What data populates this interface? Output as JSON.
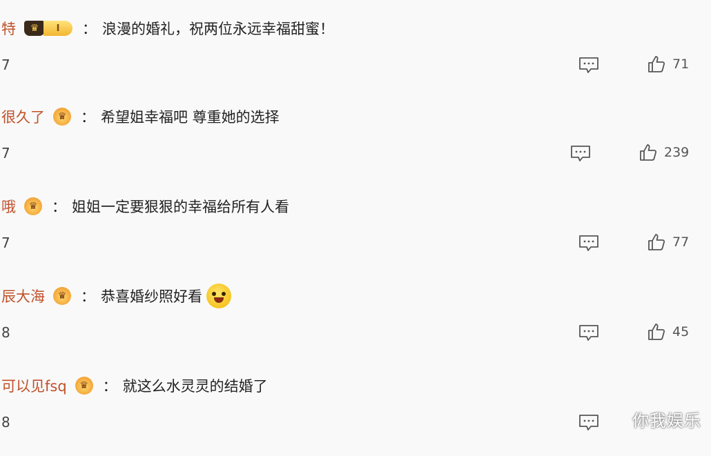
{
  "comments": [
    {
      "user": "特",
      "badge_level": "I",
      "text": "浪漫的婚礼，祝两位永远幸福甜蜜！",
      "time": "7",
      "likes": "71",
      "has_emoji": false
    },
    {
      "user": "很久了",
      "text": "希望姐幸福吧 尊重她的选择",
      "time": "7",
      "likes": "239",
      "has_emoji": false
    },
    {
      "user": "哦",
      "text": "姐姐一定要狠狠的幸福给所有人看",
      "time": "7",
      "likes": "77",
      "has_emoji": false
    },
    {
      "user": "辰大海",
      "text": "恭喜婚纱照好看",
      "time": "8",
      "likes": "45",
      "has_emoji": true
    },
    {
      "user": "可以见fsq",
      "text": "就这么水灵灵的结婚了",
      "time": "8",
      "likes": "",
      "has_emoji": false
    }
  ],
  "colon": "：",
  "watermark": "你我娱乐",
  "icons": {
    "reply": "comment-bubble-icon",
    "like": "thumbs-up-icon",
    "badge": "crown-badge-icon"
  },
  "colors": {
    "username": "#c0512a",
    "text": "#222222",
    "background": "#f9f9f9"
  }
}
